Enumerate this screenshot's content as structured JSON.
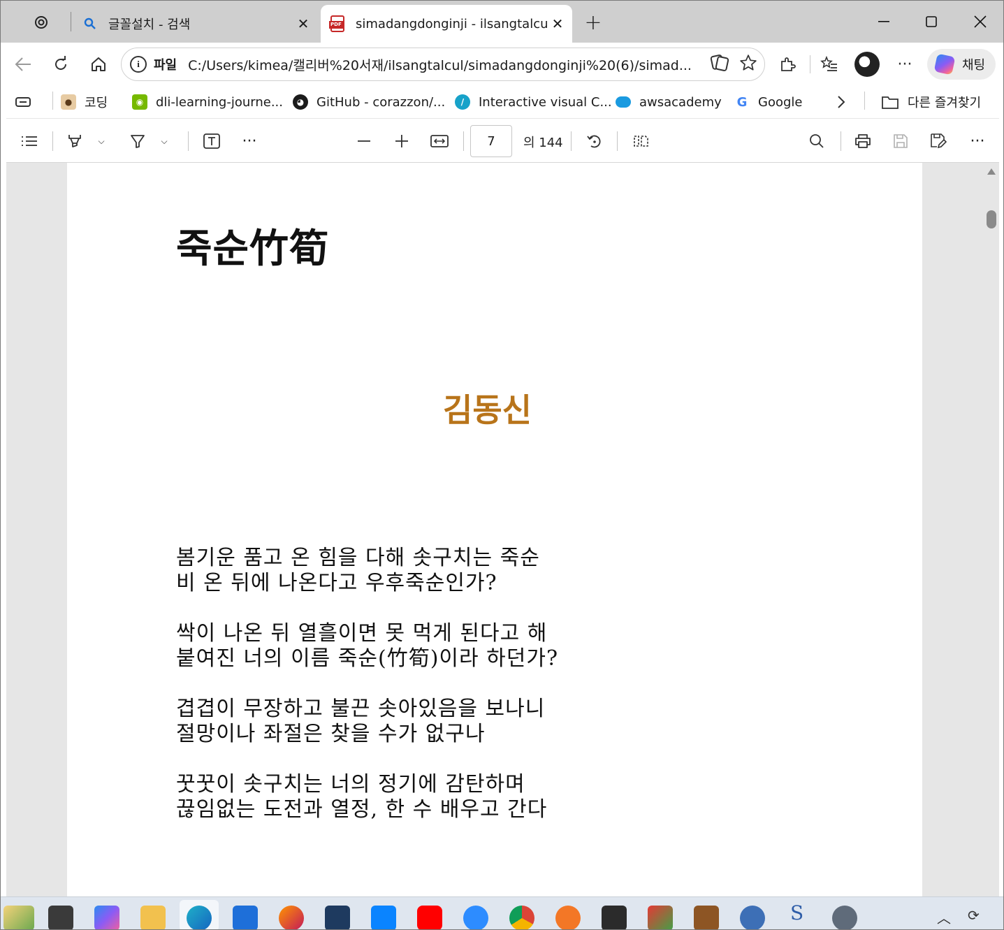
{
  "browser": {
    "tabs": [
      {
        "title": "글꼴설치 - 검색",
        "icon": "search-icon"
      },
      {
        "title": "simadangdonginji - ilsangtalcul.pdf",
        "icon": "pdf-icon"
      }
    ],
    "address": {
      "scheme": "파일",
      "url": "C:/Users/kimea/캘리버%20서재/ilsangtalcul/simadangdonginji%20(6)/simad..."
    },
    "copilot_label": "채팅"
  },
  "favorites": {
    "items": [
      {
        "label": "코딩",
        "icon": "dog-favicon",
        "color": "#d9b48a"
      },
      {
        "label": "dli-learning-journe...",
        "icon": "nvidia-icon",
        "color": "#76b900"
      },
      {
        "label": "GitHub - corazzon/...",
        "icon": "github-icon",
        "color": "#1b1b1b"
      },
      {
        "label": "Interactive visual C...",
        "icon": "slash-icon",
        "color": "#17a2c9"
      },
      {
        "label": "awsacademy",
        "icon": "cloud-icon",
        "color": "#1a9ae0"
      },
      {
        "label": "Google",
        "icon": "google-icon",
        "color": "#4285f4"
      }
    ],
    "other_label": "다른 즐겨찾기"
  },
  "pdf_toolbar": {
    "current_page": "7",
    "total_label": "의 144"
  },
  "document": {
    "title": "죽순竹筍",
    "author": "김동신",
    "stanzas": [
      [
        "봄기운 품고 온 힘을 다해 솟구치는 죽순",
        "비 온 뒤에 나온다고 우후죽순인가?"
      ],
      [
        "싹이 나온 뒤 열흘이면 못 먹게 된다고 해",
        "붙여진 너의 이름 죽순(竹筍)이라 하던가?"
      ],
      [
        "겹겹이 무장하고 불끈 솟아있음을 보나니",
        "절망이나 좌절은 찾을 수가 없구나"
      ],
      [
        "꿋꿋이 솟구치는 너의 정기에 감탄하며",
        "끊임없는 도전과 열정, 한 수 배우고 간다"
      ]
    ],
    "colors": {
      "author": "#b8741a",
      "text": "#111111"
    }
  }
}
